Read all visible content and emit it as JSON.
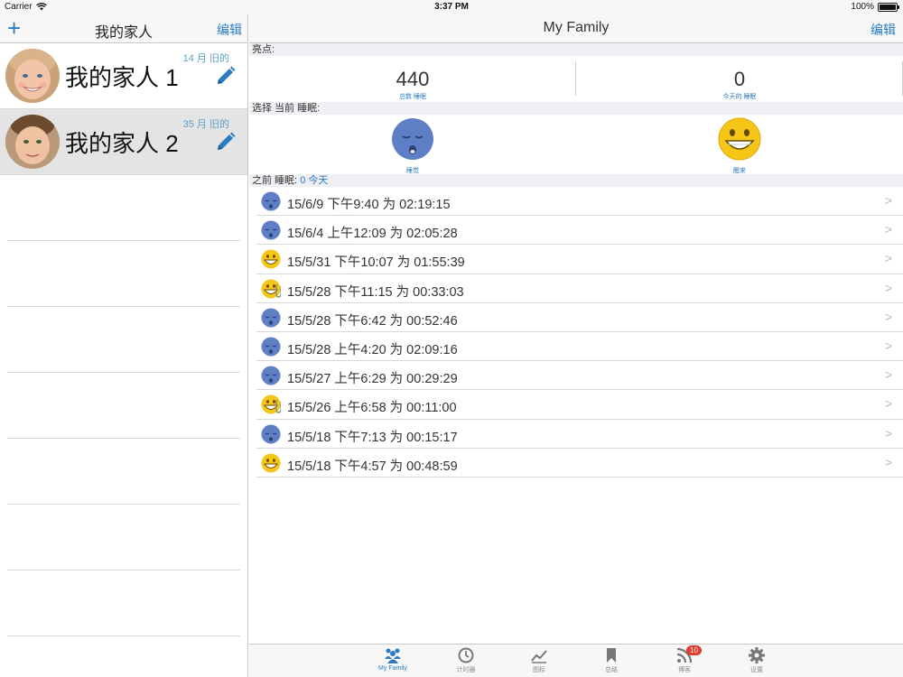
{
  "status_bar": {
    "carrier": "Carrier",
    "time": "3:37 PM",
    "battery": "100%"
  },
  "left": {
    "add_label": "+",
    "title": "我的家人",
    "edit_label": "编辑",
    "members": [
      {
        "name": "我的家人 1",
        "age": "14 月 旧的",
        "selected": false
      },
      {
        "name": "我的家人 2",
        "age": "35 月 旧的",
        "selected": true
      }
    ]
  },
  "right": {
    "title": "My Family",
    "edit_label": "编辑",
    "highlights_header": "亮点:",
    "stats": [
      {
        "value": "440",
        "label": "总数 睡眠"
      },
      {
        "value": "0",
        "label": "今天的 睡眠"
      }
    ],
    "choose_header": "选择 当前 睡眠:",
    "choices": [
      {
        "label": "睡觉",
        "icon": "sleepy-face-icon"
      },
      {
        "label": "醒来",
        "icon": "smiley-face-icon"
      }
    ],
    "previous_header": "之前 睡眠:",
    "previous_today": "0 今天",
    "sleeps": [
      {
        "text": "15/6/9 下午9:40 为 02:19:15",
        "icon": "sleepy"
      },
      {
        "text": "15/6/4 上午12:09 为 02:05:28",
        "icon": "sleepy"
      },
      {
        "text": "15/5/31 下午10:07 为 01:55:39",
        "icon": "smiley"
      },
      {
        "text": "15/5/28 下午11:15 为 00:33:03",
        "icon": "smiley-clip"
      },
      {
        "text": "15/5/28 下午6:42 为 00:52:46",
        "icon": "sleepy"
      },
      {
        "text": "15/5/28 上午4:20 为 02:09:16",
        "icon": "sleepy"
      },
      {
        "text": "15/5/27 上午6:29 为 00:29:29",
        "icon": "sleepy"
      },
      {
        "text": "15/5/26 上午6:58 为 00:11:00",
        "icon": "smiley-clip"
      },
      {
        "text": "15/5/18 下午7:13 为 00:15:17",
        "icon": "sleepy"
      },
      {
        "text": "15/5/18 下午4:57 为 00:48:59",
        "icon": "smiley"
      }
    ]
  },
  "tabbar": {
    "tabs": [
      {
        "label": "My Family",
        "icon": "family-icon",
        "active": true
      },
      {
        "label": "计时器",
        "icon": "clock-icon"
      },
      {
        "label": "图标",
        "icon": "chart-icon"
      },
      {
        "label": "总结",
        "icon": "bookmark-icon"
      },
      {
        "label": "博客",
        "icon": "rss-icon",
        "badge": "10"
      },
      {
        "label": "设置",
        "icon": "gear-icon"
      }
    ]
  },
  "colors": {
    "accent": "#2a7bc0",
    "sleepy": "#5e7fc6",
    "smiley": "#f5c518",
    "badge": "#e63b30"
  }
}
